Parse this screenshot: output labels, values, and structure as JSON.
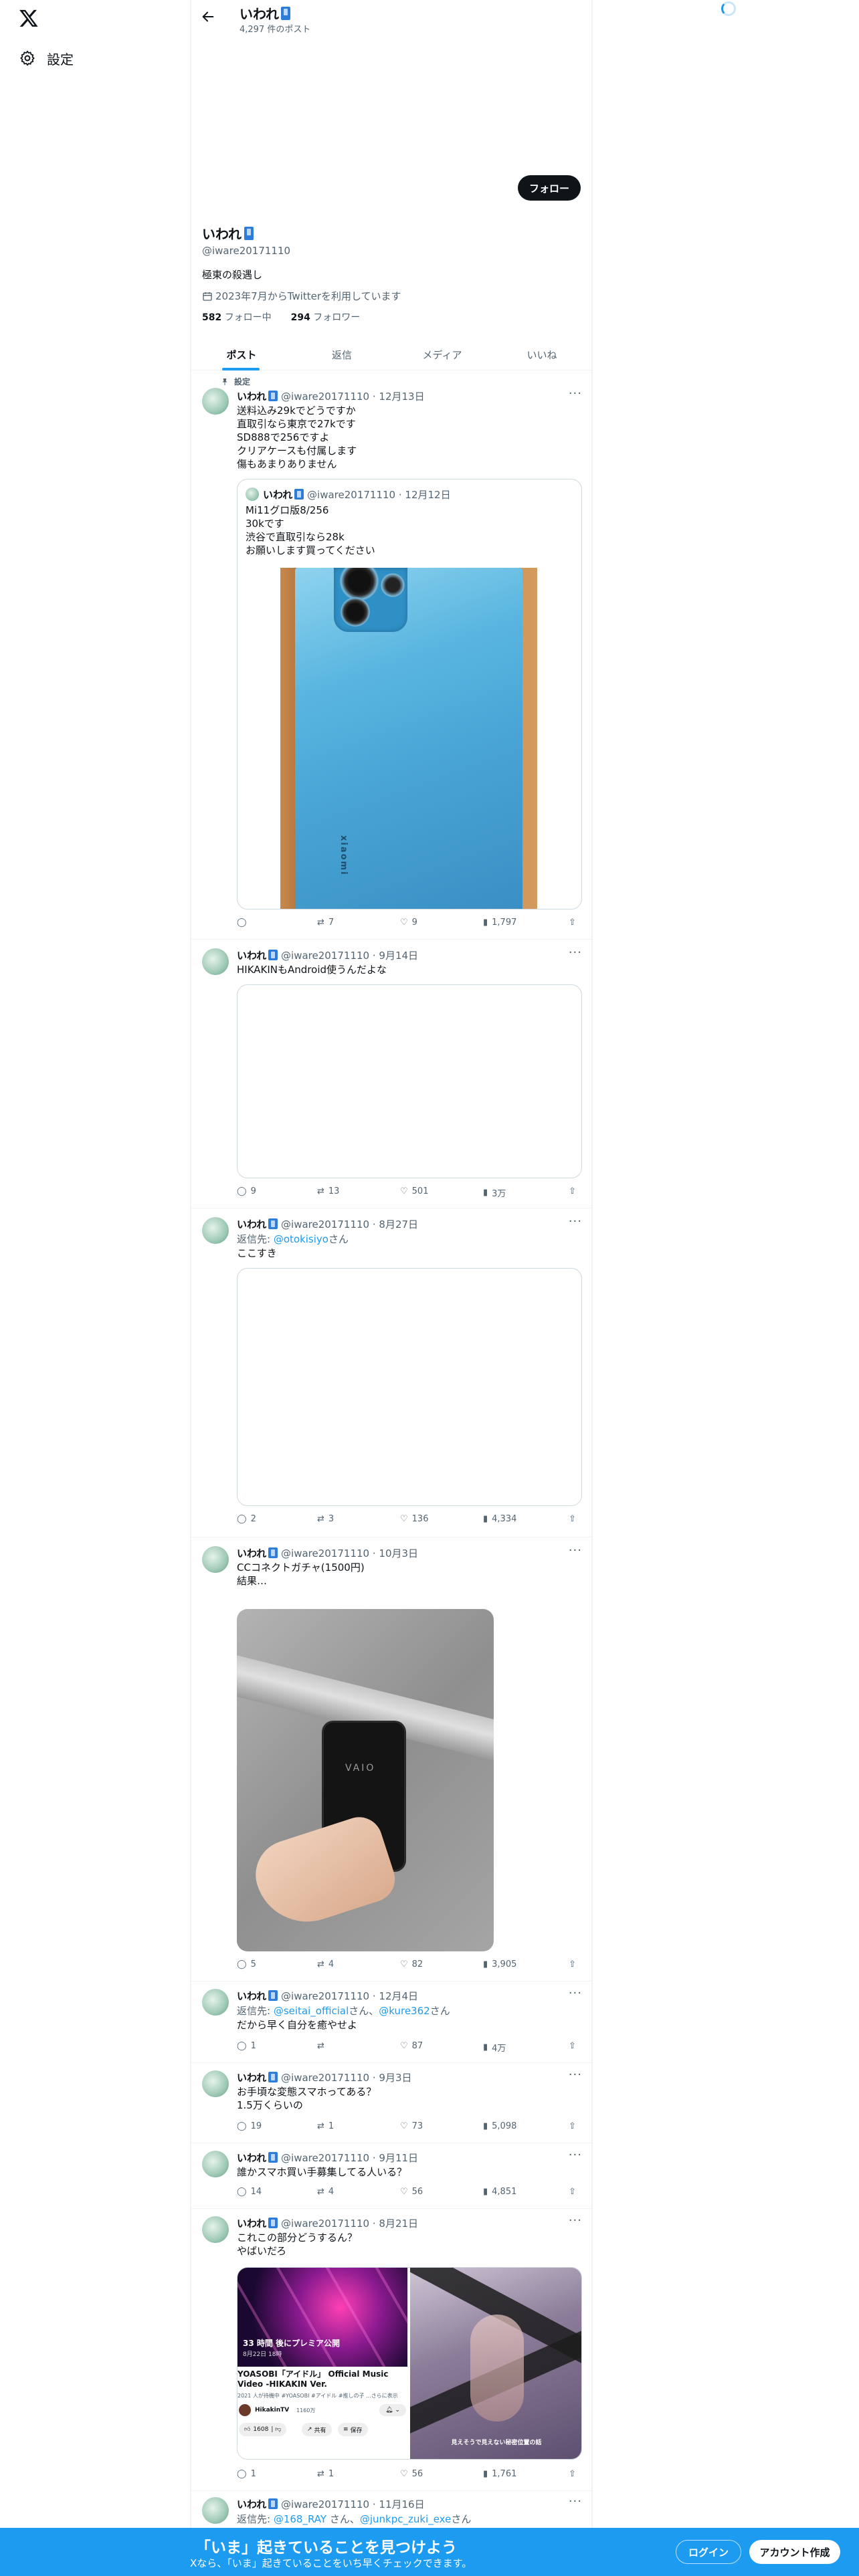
{
  "sidebar": {
    "settings_label": "設定"
  },
  "header": {
    "name": "いわれ",
    "post_count": "4,297 件のポスト"
  },
  "profile": {
    "name": "いわれ",
    "handle": "@iware20171110",
    "follow_label": "フォロー",
    "bio": "極東の殺遇し",
    "joined": "2023年7月からTwitterを利用しています",
    "following_count": "582",
    "following_label": "フォロー中",
    "followers_count": "294",
    "followers_label": "フォロワー"
  },
  "tabs": [
    {
      "label": "ポスト",
      "active": true
    },
    {
      "label": "返信"
    },
    {
      "label": "メディア"
    },
    {
      "label": "いいね"
    }
  ],
  "pinned": {
    "label": "設定"
  },
  "tweets": [
    {
      "name": "いわれ",
      "handle": "@iware20171110",
      "date": "· 12月13日",
      "text": "送料込み29kでどうですか\n直取引なら東京で27kです\nSD888で256ですよ\nクリアケースも付属します\n傷もあまりありません",
      "quote": {
        "name": "いわれ",
        "handle": "@iware20171110",
        "date": "· 12月12日",
        "text": "Mi11グロ版8/256\n30kです\n渋谷で直取引なら28k\nお願いします買ってください"
      },
      "counts": {
        "reply": "",
        "retweet": "7",
        "like": "9",
        "views": "1,797"
      }
    },
    {
      "name": "いわれ",
      "handle": "@iware20171110",
      "date": "· 9月14日",
      "text": "HIKAKINもAndroid使うんだよな",
      "counts": {
        "reply": "9",
        "retweet": "13",
        "like": "501",
        "views": "3万"
      }
    },
    {
      "name": "いわれ",
      "handle": "@iware20171110",
      "date": "· 8月27日",
      "reply_to_prefix": "返信先: ",
      "reply_to": "@otokisiyo",
      "reply_to_suffix": "さん",
      "text": "ここすき",
      "counts": {
        "reply": "2",
        "retweet": "3",
        "like": "136",
        "views": "4,334"
      }
    },
    {
      "name": "いわれ",
      "handle": "@iware20171110",
      "date": "· 10月3日",
      "text": "CCコネクトガチャ(1500円)\n結果…",
      "image_caption": "VAIO",
      "counts": {
        "reply": "5",
        "retweet": "4",
        "like": "82",
        "views": "3,905"
      }
    },
    {
      "name": "いわれ",
      "handle": "@iware20171110",
      "date": "· 12月4日",
      "reply_to_prefix": "返信先: ",
      "reply_to": "@seitai_official",
      "reply_to_mid": "さん、",
      "reply_to2": "@kure362",
      "reply_to_suffix": "さん",
      "text": "だから早く自分を癒やせよ",
      "counts": {
        "reply": "1",
        "retweet": "",
        "like": "87",
        "views": "4万"
      }
    },
    {
      "name": "いわれ",
      "handle": "@iware20171110",
      "date": "· 9月3日",
      "text": "お手頃な変態スマホってある？\n1.5万くらいの",
      "counts": {
        "reply": "19",
        "retweet": "1",
        "like": "73",
        "views": "5,098"
      }
    },
    {
      "name": "いわれ",
      "handle": "@iware20171110",
      "date": "· 9月11日",
      "text": "誰かスマホ買い手募集してる人いる？",
      "counts": {
        "reply": "14",
        "retweet": "4",
        "like": "56",
        "views": "4,851"
      }
    },
    {
      "name": "いわれ",
      "handle": "@iware20171110",
      "date": "· 8月21日",
      "text": "これこの部分どうするん？\nやばいだろ",
      "yt": {
        "premiere": "33 時間 後にプレミア公開",
        "premiere_date": "8月22日 18時",
        "title": "YOASOBI「アイドル」 Official Music Video -HIKAKIN Ver.",
        "meta": "2021 人が待機中 #YOASOBI #アイドル #推しの子 ...さらに表示",
        "channel": "HikakinTV",
        "subs": "1160万",
        "like_count": "1608",
        "share": "共有",
        "save": "保存"
      },
      "right_caption": "見えそうで見えない秘密位置の話",
      "counts": {
        "reply": "1",
        "retweet": "1",
        "like": "56",
        "views": "1,761"
      }
    },
    {
      "name": "いわれ",
      "handle": "@iware20171110",
      "date": "· 11月16日",
      "reply_to_prefix": "返信先: ",
      "reply_to": "@168_RAY",
      "reply_to_mid": " さん、",
      "reply_to2": "@junkpc_zuki_exe",
      "reply_to_suffix": "さん"
    }
  ],
  "banner": {
    "title": "「いま」起きていることを見つけよう",
    "subtitle": "Xなら、「いま」起きていることをいち早くチェックできます。",
    "login": "ログイン",
    "signup": "アカウント作成"
  },
  "colors": {
    "accent": "#1d9bf0",
    "banner": "#1d9bf0",
    "text": "#0f1419",
    "muted": "#536471"
  }
}
